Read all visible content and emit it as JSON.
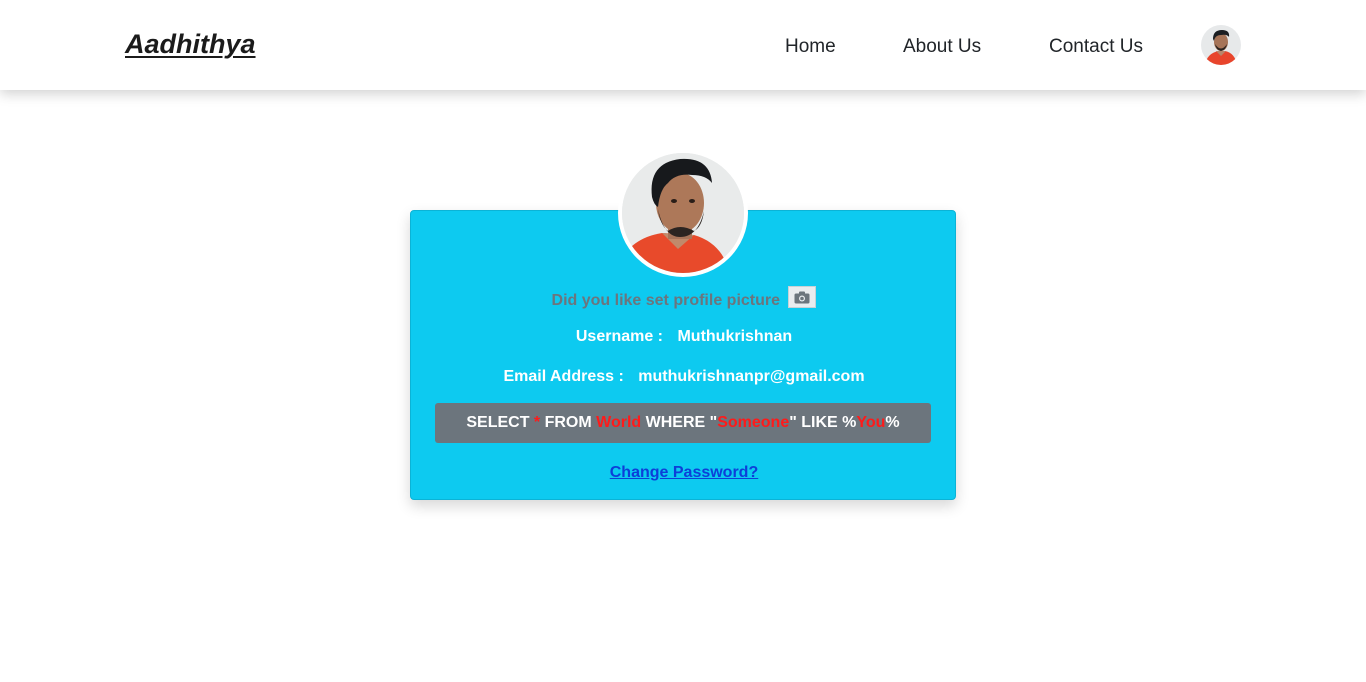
{
  "navbar": {
    "brand": "Aadhithya",
    "links": [
      {
        "label": "Home"
      },
      {
        "label": "About Us"
      },
      {
        "label": "Contact Us"
      }
    ],
    "avatar_icon": "user-avatar-photo"
  },
  "profile_card": {
    "set_picture_prompt": "Did you like set profile picture",
    "camera_icon": "camera-icon",
    "username_label": "Username :",
    "username_value": "Muthukrishnan",
    "email_label": "Email Address :",
    "email_value": "muthukrishnanpr@gmail.com",
    "sql_quote": {
      "p1": "SELECT ",
      "p2": "*",
      "p3": " FROM ",
      "p4": "World",
      "p5": " WHERE \"",
      "p6": "Someone",
      "p7": "\" LIKE %",
      "p8": "You",
      "p9": "%"
    },
    "change_password": "Change Password?"
  },
  "colors": {
    "card_background": "#0dcaf0",
    "quote_bar": "#6c757d",
    "highlight_red": "#ff1a1a",
    "link_blue": "#0d3fd8"
  }
}
